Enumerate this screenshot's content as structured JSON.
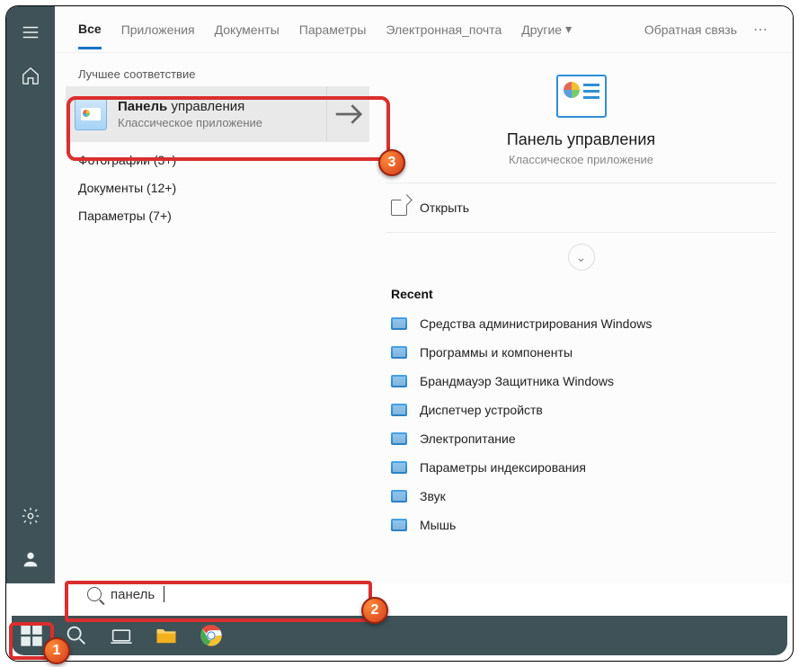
{
  "tabs": {
    "all": "Все",
    "apps": "Приложения",
    "docs": "Документы",
    "params": "Параметры",
    "email": "Электронная_почта",
    "more": "Другие",
    "feedback": "Обратная связь"
  },
  "section": {
    "best_match": "Лучшее соответствие"
  },
  "result": {
    "title_bold": "Панель",
    "title_rest": " управления",
    "subtitle": "Классическое приложение"
  },
  "subs": {
    "photos": "Фотографии (3+)",
    "documents": "Документы (12+)",
    "params": "Параметры (7+)"
  },
  "detail": {
    "title": "Панель управления",
    "subtitle": "Классическое приложение",
    "open": "Открыть",
    "recent_label": "Recent",
    "recent": [
      "Средства администрирования Windows",
      "Программы и компоненты",
      "Брандмауэр Защитника Windows",
      "Диспетчер устройств",
      "Электропитание",
      "Параметры индексирования",
      "Звук",
      "Мышь"
    ]
  },
  "search": {
    "value": "панель"
  },
  "badges": {
    "n1": "1",
    "n2": "2",
    "n3": "3"
  }
}
